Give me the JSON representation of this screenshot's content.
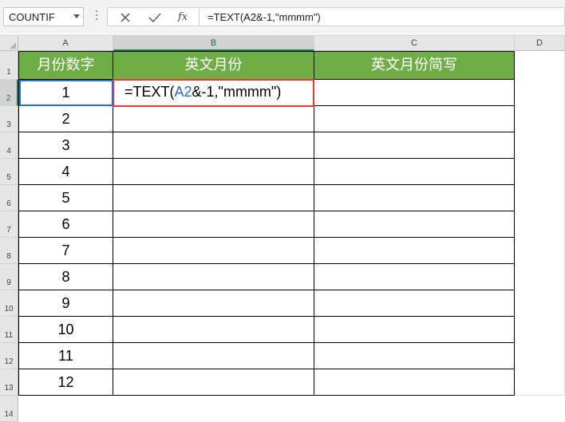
{
  "formula_bar": {
    "name_box": "COUNTIF",
    "cancel_icon": "x-icon",
    "enter_icon": "check-icon",
    "fx_label": "fx",
    "formula": "=TEXT(A2&-1,\"mmmm\")"
  },
  "columns": [
    "A",
    "B",
    "C",
    "D"
  ],
  "rows": [
    "1",
    "2",
    "3",
    "4",
    "5",
    "6",
    "7",
    "8",
    "9",
    "10",
    "11",
    "12",
    "13",
    "14"
  ],
  "headers": {
    "a": "月份数字",
    "b": "英文月份",
    "c": "英文月份简写"
  },
  "month_numbers": [
    "1",
    "2",
    "3",
    "4",
    "5",
    "6",
    "7",
    "8",
    "9",
    "10",
    "11",
    "12"
  ],
  "edit_cell": {
    "prefix": "=TEXT(",
    "ref": "A2",
    "suffix": "&-1,\"mmmm\")"
  },
  "colors": {
    "header_fill": "#70ad47",
    "edit_border": "#e53935",
    "ref_color": "#2b6cc4",
    "selection": "#217346"
  }
}
